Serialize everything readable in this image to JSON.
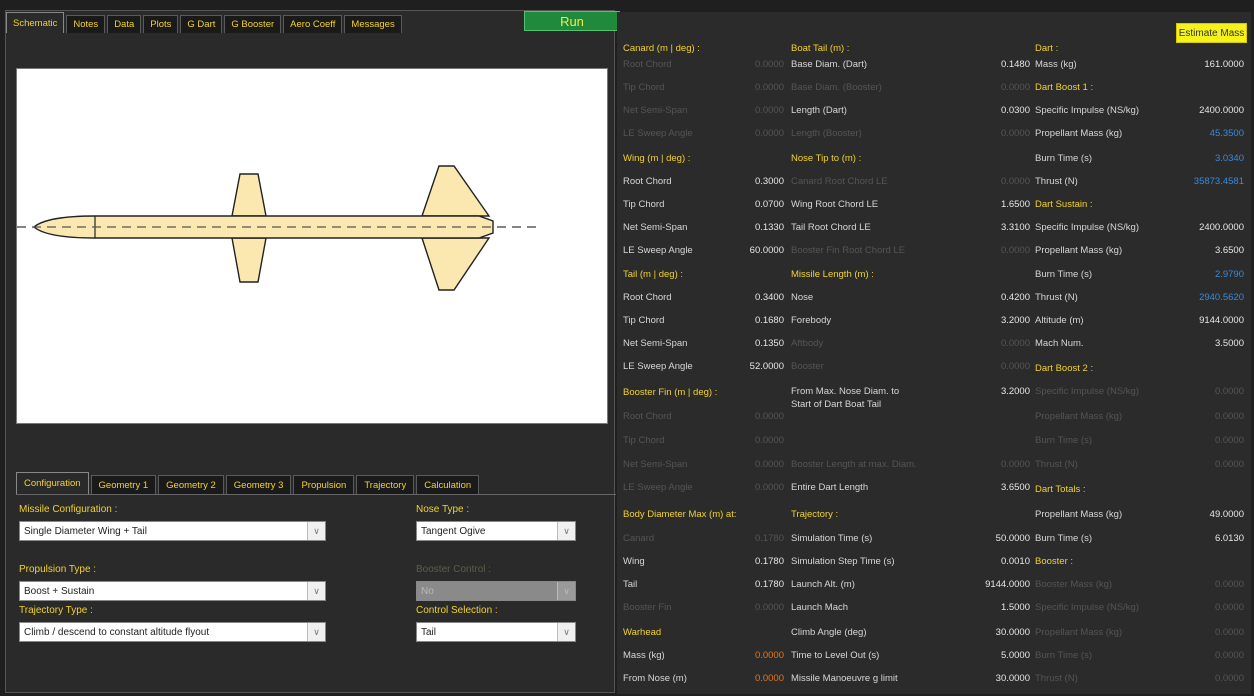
{
  "top_tabs": [
    "Schematic",
    "Notes",
    "Data",
    "Plots",
    "G Dart",
    "G Booster",
    "Aero Coeff",
    "Messages"
  ],
  "run_label": "Run",
  "bottom_tabs": [
    "Configuration",
    "Geometry 1",
    "Geometry 2",
    "Geometry 3",
    "Propulsion",
    "Trajectory",
    "Calculation"
  ],
  "config": {
    "missile_configuration_label": "Missile Configuration :",
    "missile_configuration_value": "Single Diameter Wing + Tail",
    "nose_type_label": "Nose Type :",
    "nose_type_value": "Tangent Ogive",
    "propulsion_type_label": "Propulsion Type :",
    "propulsion_type_value": "Boost + Sustain",
    "booster_control_label": "Booster Control :",
    "booster_control_value": "No",
    "trajectory_type_label": "Trajectory Type :",
    "trajectory_type_value": "Climb / descend to constant altitude flyout",
    "control_selection_label": "Control Selection :",
    "control_selection_value": "Tail"
  },
  "estimate_mass_label": "Estimate Mass",
  "canard": {
    "heading": "Canard (m | deg) :",
    "root_chord": "Root Chord",
    "root_chord_v": "0.0000",
    "tip_chord": "Tip Chord",
    "tip_chord_v": "0.0000",
    "net_semi_span": "Net Semi-Span",
    "net_semi_span_v": "0.0000",
    "le_sweep": "LE Sweep Angle",
    "le_sweep_v": "0.0000"
  },
  "wing": {
    "heading": "Wing (m | deg) :",
    "root_chord": "Root Chord",
    "root_chord_v": "0.3000",
    "tip_chord": "Tip Chord",
    "tip_chord_v": "0.0700",
    "net_semi_span": "Net Semi-Span",
    "net_semi_span_v": "0.1330",
    "le_sweep": "LE Sweep Angle",
    "le_sweep_v": "60.0000"
  },
  "tail": {
    "heading": "Tail (m | deg) :",
    "root_chord": "Root Chord",
    "root_chord_v": "0.3400",
    "tip_chord": "Tip Chord",
    "tip_chord_v": "0.1680",
    "net_semi_span": "Net Semi-Span",
    "net_semi_span_v": "0.1350",
    "le_sweep": "LE Sweep Angle",
    "le_sweep_v": "52.0000"
  },
  "booster_fin": {
    "heading": "Booster Fin (m | deg) :",
    "root_chord": "Root Chord",
    "root_chord_v": "0.0000",
    "tip_chord": "Tip Chord",
    "tip_chord_v": "0.0000",
    "net_semi_span": "Net Semi-Span",
    "net_semi_span_v": "0.0000",
    "le_sweep": "LE Sweep Angle",
    "le_sweep_v": "0.0000"
  },
  "body_diameter": {
    "heading": "Body Diameter Max (m) at:",
    "canard": "Canard",
    "canard_v": "0.1780",
    "wing": "Wing",
    "wing_v": "0.1780",
    "tail": "Tail",
    "tail_v": "0.1780",
    "booster_fin": "Booster Fin",
    "booster_fin_v": "0.0000"
  },
  "warhead": {
    "heading": "Warhead",
    "mass": "Mass (kg)",
    "mass_v": "0.0000",
    "from_nose": "From Nose (m)",
    "from_nose_v": "0.0000"
  },
  "boat_tail": {
    "heading": "Boat Tail (m) :",
    "base_diam_dart": "Base Diam. (Dart)",
    "base_diam_dart_v": "0.1480",
    "base_diam_booster": "Base Diam. (Booster)",
    "base_diam_booster_v": "0.0000",
    "length_dart": "Length (Dart)",
    "length_dart_v": "0.0300",
    "length_booster": "Length (Booster)",
    "length_booster_v": "0.0000"
  },
  "nose_tip": {
    "heading": "Nose Tip to (m) :",
    "canard_root": "Canard Root Chord LE",
    "canard_root_v": "0.0000",
    "wing_root": "Wing Root Chord LE",
    "wing_root_v": "1.6500",
    "tail_root": "Tail Root Chord LE",
    "tail_root_v": "3.3100",
    "booster_fin_root": "Booster Fin Root Chord LE",
    "booster_fin_root_v": "0.0000"
  },
  "missile_length": {
    "heading": "Missile Length (m) :",
    "nose": "Nose",
    "nose_v": "0.4200",
    "forebody": "Forebody",
    "forebody_v": "3.2000",
    "aftbody": "Aftbody",
    "aftbody_v": "0.0000",
    "booster": "Booster",
    "booster_v": "0.0000",
    "from_max_nose": "From Max. Nose Diam. to",
    "from_max_nose2": "Start of Dart Boat Tail",
    "from_max_nose_v": "3.2000",
    "booster_length_max": "Booster Length at max. Diam.",
    "booster_length_max_v": "0.0000",
    "entire_dart": "Entire Dart Length",
    "entire_dart_v": "3.6500"
  },
  "trajectory": {
    "heading": "Trajectory :",
    "sim_time": "Simulation Time (s)",
    "sim_time_v": "50.0000",
    "sim_step": "Simulation Step Time (s)",
    "sim_step_v": "0.0010",
    "launch_alt": "Launch Alt. (m)",
    "launch_alt_v": "9144.0000",
    "launch_mach": "Launch Mach",
    "launch_mach_v": "1.5000",
    "climb_angle": "Climb Angle (deg)",
    "climb_angle_v": "30.0000",
    "time_level": "Time to Level Out (s)",
    "time_level_v": "5.0000",
    "manoeuvre": "Missile Manoeuvre g limit",
    "manoeuvre_v": "30.0000"
  },
  "dart": {
    "heading": "Dart :",
    "mass": "Mass (kg)",
    "mass_v": "161.0000"
  },
  "dart_boost1": {
    "heading": "Dart Boost 1 :",
    "isp": "Specific Impulse (NS/kg)",
    "isp_v": "2400.0000",
    "prop_mass": "Propellant Mass (kg)",
    "prop_mass_v": "45.3500",
    "burn_time": "Burn Time (s)",
    "burn_time_v": "3.0340",
    "thrust": "Thrust (N)",
    "thrust_v": "35873.4581"
  },
  "dart_sustain": {
    "heading": "Dart Sustain :",
    "isp": "Specific Impulse (NS/kg)",
    "isp_v": "2400.0000",
    "prop_mass": "Propellant Mass (kg)",
    "prop_mass_v": "3.6500",
    "burn_time": "Burn Time (s)",
    "burn_time_v": "2.9790",
    "thrust": "Thrust (N)",
    "thrust_v": "2940.5620",
    "altitude": "Altitude (m)",
    "altitude_v": "9144.0000",
    "mach": "Mach Num.",
    "mach_v": "3.5000"
  },
  "dart_boost2": {
    "heading": "Dart Boost 2 :",
    "isp": "Specific Impulse (NS/kg)",
    "isp_v": "0.0000",
    "prop_mass": "Propellant Mass (kg)",
    "prop_mass_v": "0.0000",
    "burn_time": "Burn Time (s)",
    "burn_time_v": "0.0000",
    "thrust": "Thrust (N)",
    "thrust_v": "0.0000"
  },
  "dart_totals": {
    "heading": "Dart Totals :",
    "prop_mass": "Propellant Mass (kg)",
    "prop_mass_v": "49.0000",
    "burn_time": "Burn Time (s)",
    "burn_time_v": "6.0130"
  },
  "booster": {
    "heading": "Booster :",
    "mass": "Booster Mass (kg)",
    "mass_v": "0.0000",
    "isp": "Specific Impulse (NS/kg)",
    "isp_v": "0.0000",
    "prop_mass": "Propellant Mass (kg)",
    "prop_mass_v": "0.0000",
    "burn_time": "Burn Time (s)",
    "burn_time_v": "0.0000",
    "thrust": "Thrust (N)",
    "thrust_v": "0.0000"
  },
  "colors": {
    "accent_yellow": "#f2d22e",
    "run_green": "#1f8a3b",
    "value_blue": "#3b8ad8",
    "value_orange": "#e8731e",
    "missile_fill": "#fbe8b0"
  }
}
